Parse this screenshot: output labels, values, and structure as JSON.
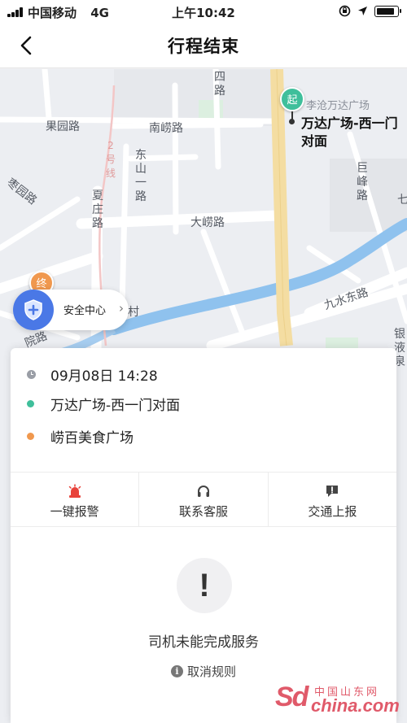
{
  "status_bar": {
    "carrier": "中国移动",
    "network": "4G",
    "time": "上午10:42",
    "battery_level": 0.9
  },
  "nav": {
    "title": "行程结束",
    "back_icon": "chevron-left-icon"
  },
  "map": {
    "roads": [
      "四路",
      "果园路",
      "南崂路",
      "东山一路",
      "2号线",
      "夏庄路",
      "巨峰路",
      "大崂路",
      "枣园路",
      "九水东路",
      "银液泉",
      "院路",
      "七"
    ],
    "start_marker": "起",
    "start_poi": "李沧万达广场",
    "start_name": "万达广场-西一门对面",
    "end_marker": "终",
    "partial_poi": "村"
  },
  "safety_center": {
    "label": "安全中心",
    "icon": "shield-plus-icon"
  },
  "trip": {
    "time": "09月08日 14:28",
    "from": "万达广场-西一门对面",
    "to": "崂百美食广场",
    "colors": {
      "from": "#3fbf9b",
      "to": "#f0984e",
      "time": "#9a9ea6"
    }
  },
  "actions": [
    {
      "label": "一键报警",
      "icon": "alarm-siren-icon"
    },
    {
      "label": "联系客服",
      "icon": "headset-icon"
    },
    {
      "label": "交通上报",
      "icon": "report-bubble-icon"
    }
  ],
  "result": {
    "icon_text": "!",
    "message": "司机未能完成服务",
    "rules_label": "取消规则"
  },
  "watermark": {
    "logo": "Sd",
    "cn": "中国山东网",
    "url": "china.com"
  }
}
